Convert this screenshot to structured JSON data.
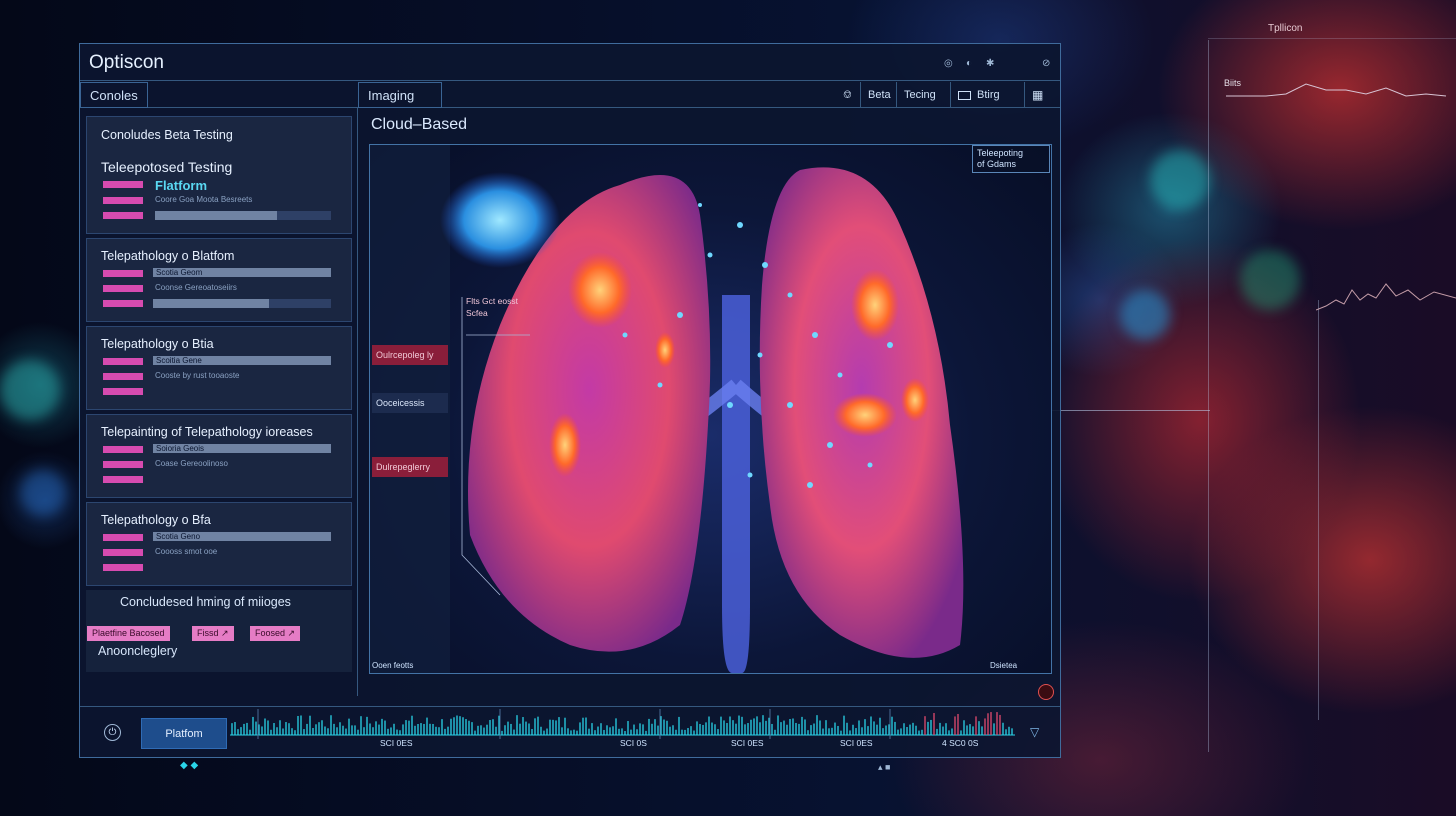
{
  "app": {
    "title": "Optiscon"
  },
  "window_controls": [
    "◎",
    "◐",
    "✱",
    "⊘"
  ],
  "tabs": {
    "left": "Conoles",
    "center": "Imaging"
  },
  "toolbar": {
    "bell_icon": "bell-icon",
    "beta_label": "Beta",
    "testing_label": "Tecing",
    "settings_label": "Btirg"
  },
  "section_title": "Cloud–Based",
  "left_panel": {
    "cards": [
      {
        "title": "Conoludes Beta Testing",
        "subtitle": "Teleepotosed Testing",
        "highlight": "Flatform",
        "tiny": "Coore Goa Moota Besreets"
      },
      {
        "title": "Telepathology o Blatfom",
        "bar_label": "Scotia Geom",
        "tiny": "Coonse Gereoatoseiirs"
      },
      {
        "title": "Telepathology o Btia",
        "bar_label": "Scoitia Gene",
        "tiny": "Cooste by rust tooaoste"
      },
      {
        "title": "Telepainting of Telepathology ioreases",
        "bar_label": "Soioria Geois",
        "tiny": "Coase Gereoolinoso"
      },
      {
        "title": "Telepathology o Bfa",
        "bar_label": "Scotia Geno",
        "tiny": "Coooss smot ooe"
      }
    ],
    "footer_title": "Concludesed hming of miioges",
    "tags": [
      "Plaetfine Bacosed",
      "Fissd ↗",
      "Foosed ↗"
    ],
    "footer_subtitle": "Anooncleglery"
  },
  "viewer": {
    "overlay": {
      "line1": "Teleepoting",
      "line2": "of Gdams"
    },
    "annotation": {
      "line1": "Flts Gct eosst",
      "line2": "Scfea"
    },
    "side_labels": [
      "Oulrcepoleg ly",
      "Ooceicessis",
      "Dulrepeglerry"
    ],
    "bottom_left": "Ooen feotts",
    "bottom_right": "Dsietea"
  },
  "timeline": {
    "power_icon": "power-icon",
    "button": "Platfom",
    "labels": [
      "SCI 0ES",
      "SCI 0S",
      "SCI 0ES",
      "SCI 0ES",
      "4 SC0 0S"
    ],
    "arrow": "▽"
  },
  "background": {
    "top_right_label": "Tpllicon",
    "right_label": "Biits"
  },
  "colors": {
    "accent": "#1e4d8c",
    "pink": "#d64bb0",
    "cyan": "#2ad4e8",
    "panel_border": "#3f6b9c"
  }
}
